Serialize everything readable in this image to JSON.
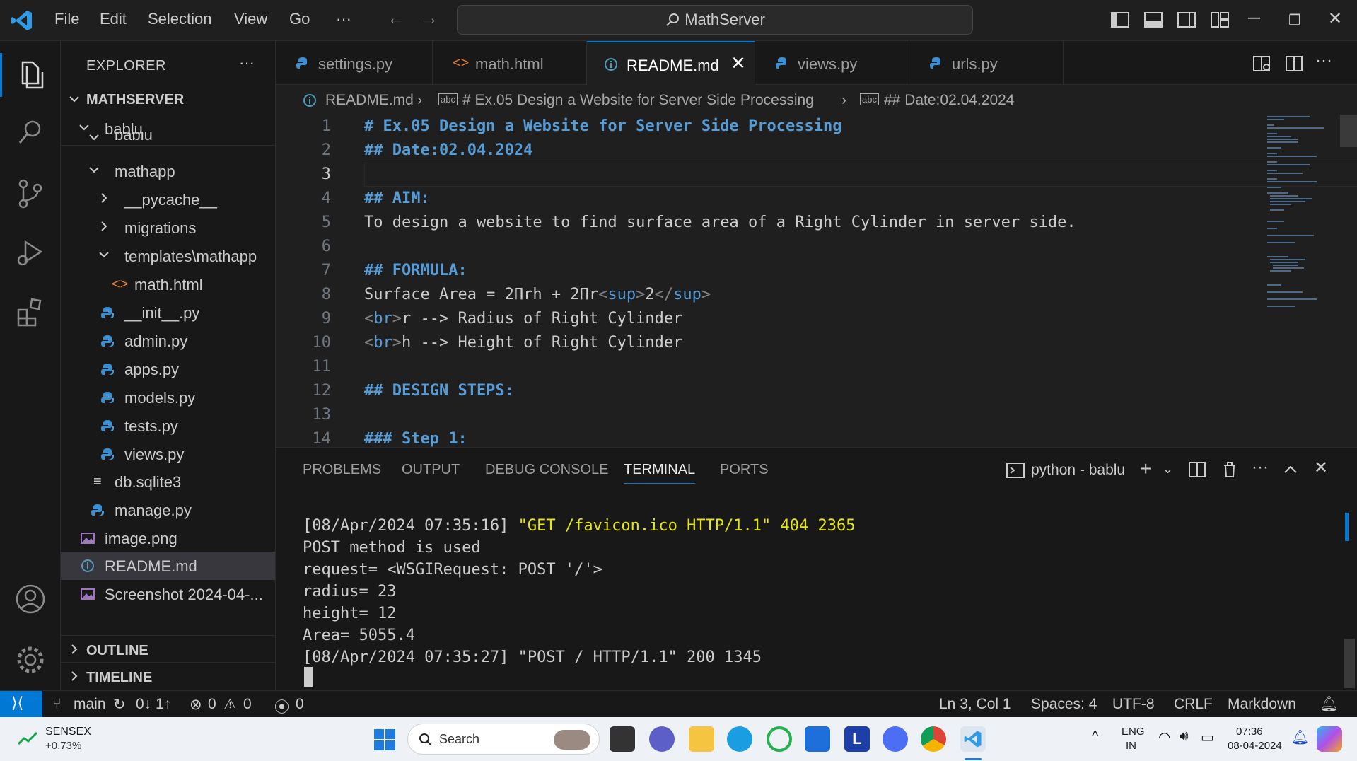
{
  "titlebar": {
    "menu": [
      "File",
      "Edit",
      "Selection",
      "View",
      "Go",
      "···"
    ],
    "search_text": "MathServer"
  },
  "sidebar": {
    "title": "EXPLORER",
    "root": "MATHSERVER",
    "items": [
      {
        "label": "bablu",
        "kind": "folder-open"
      },
      {
        "label": "bablu",
        "kind": "folder-open-sticky"
      },
      {
        "label": "mathapp",
        "kind": "folder-open"
      },
      {
        "label": "__pycache__",
        "kind": "folder"
      },
      {
        "label": "migrations",
        "kind": "folder"
      },
      {
        "label": "templates\\mathapp",
        "kind": "folder-open"
      },
      {
        "label": "math.html",
        "kind": "html"
      },
      {
        "label": "__init__.py",
        "kind": "python"
      },
      {
        "label": "admin.py",
        "kind": "python"
      },
      {
        "label": "apps.py",
        "kind": "python"
      },
      {
        "label": "models.py",
        "kind": "python"
      },
      {
        "label": "tests.py",
        "kind": "python"
      },
      {
        "label": "views.py",
        "kind": "python"
      },
      {
        "label": "db.sqlite3",
        "kind": "db"
      },
      {
        "label": "manage.py",
        "kind": "python"
      },
      {
        "label": "image.png",
        "kind": "image"
      },
      {
        "label": "README.md",
        "kind": "info"
      },
      {
        "label": "Screenshot 2024-04-...",
        "kind": "image"
      }
    ],
    "outline": "OUTLINE",
    "timeline": "TIMELINE"
  },
  "tabs": [
    {
      "label": "settings.py",
      "kind": "python"
    },
    {
      "label": "math.html",
      "kind": "html"
    },
    {
      "label": "README.md",
      "kind": "info",
      "active": true
    },
    {
      "label": "views.py",
      "kind": "python"
    },
    {
      "label": "urls.py",
      "kind": "python"
    }
  ],
  "breadcrumb": {
    "file": "README.md",
    "h1": "# Ex.05 Design a Website for Server Side Processing",
    "h2": "## Date:02.04.2024"
  },
  "editor": {
    "line_numbers": [
      "1",
      "2",
      "3",
      "4",
      "5",
      "6",
      "7",
      "8",
      "9",
      "10",
      "11",
      "12",
      "13",
      "14"
    ],
    "current_line": "3",
    "lines": {
      "l1": "# Ex.05 Design a Website for Server Side Processing",
      "l2": "## Date:02.04.2024",
      "l4": "## AIM:",
      "l5": "To design a website to find surface area of a Right Cylinder in server side.",
      "l7": "## FORMULA:",
      "l8_text": "Surface Area = 2Πrh + 2Πr",
      "l8_tag_open": "sup",
      "l8_inner": "2",
      "l8_tag_close": "sup",
      "l9_tag": "br",
      "l9_text": "r --> Radius of Right Cylinder",
      "l10_tag": "br",
      "l10_text": "h --> Height of Right Cylinder",
      "l12": "## DESIGN STEPS:",
      "l14": "### Step 1:"
    }
  },
  "panel": {
    "tabs": [
      "PROBLEMS",
      "OUTPUT",
      "DEBUG CONSOLE",
      "TERMINAL",
      "PORTS"
    ],
    "active_tab": "TERMINAL",
    "terminal_name": "python - bablu",
    "lines": {
      "t1_ts": "[08/Apr/2024 07:35:16]",
      "t1_req": "\"GET /favicon.ico HTTP/1.1\" 404 2365",
      "t2": "POST method is used",
      "t3": "request= <WSGIRequest: POST '/'>",
      "t4": "radius= 23",
      "t5": "height= 12",
      "t6": "Area= 5055.4",
      "t7": "[08/Apr/2024 07:35:27] \"POST / HTTP/1.1\" 200 1345"
    }
  },
  "statusbar": {
    "branch": "main",
    "sync": "0↓ 1↑",
    "errors": "0",
    "warnings": "0",
    "ports": "0",
    "position": "Ln 3, Col 1",
    "spaces": "Spaces: 4",
    "encoding": "UTF-8",
    "eol": "CRLF",
    "language": "Markdown"
  },
  "taskbar": {
    "stock_name": "SENSEX",
    "stock_change": "+0.73%",
    "search": "Search",
    "lang_top": "ENG",
    "lang_bottom": "IN",
    "time": "07:36",
    "date": "08-04-2024"
  },
  "colors": {
    "accent": "#0078d4",
    "heading": "#569cd6",
    "terminal_yellow": "#e5e510",
    "python_icon": "#3b8fd4",
    "html_icon": "#e37933"
  }
}
